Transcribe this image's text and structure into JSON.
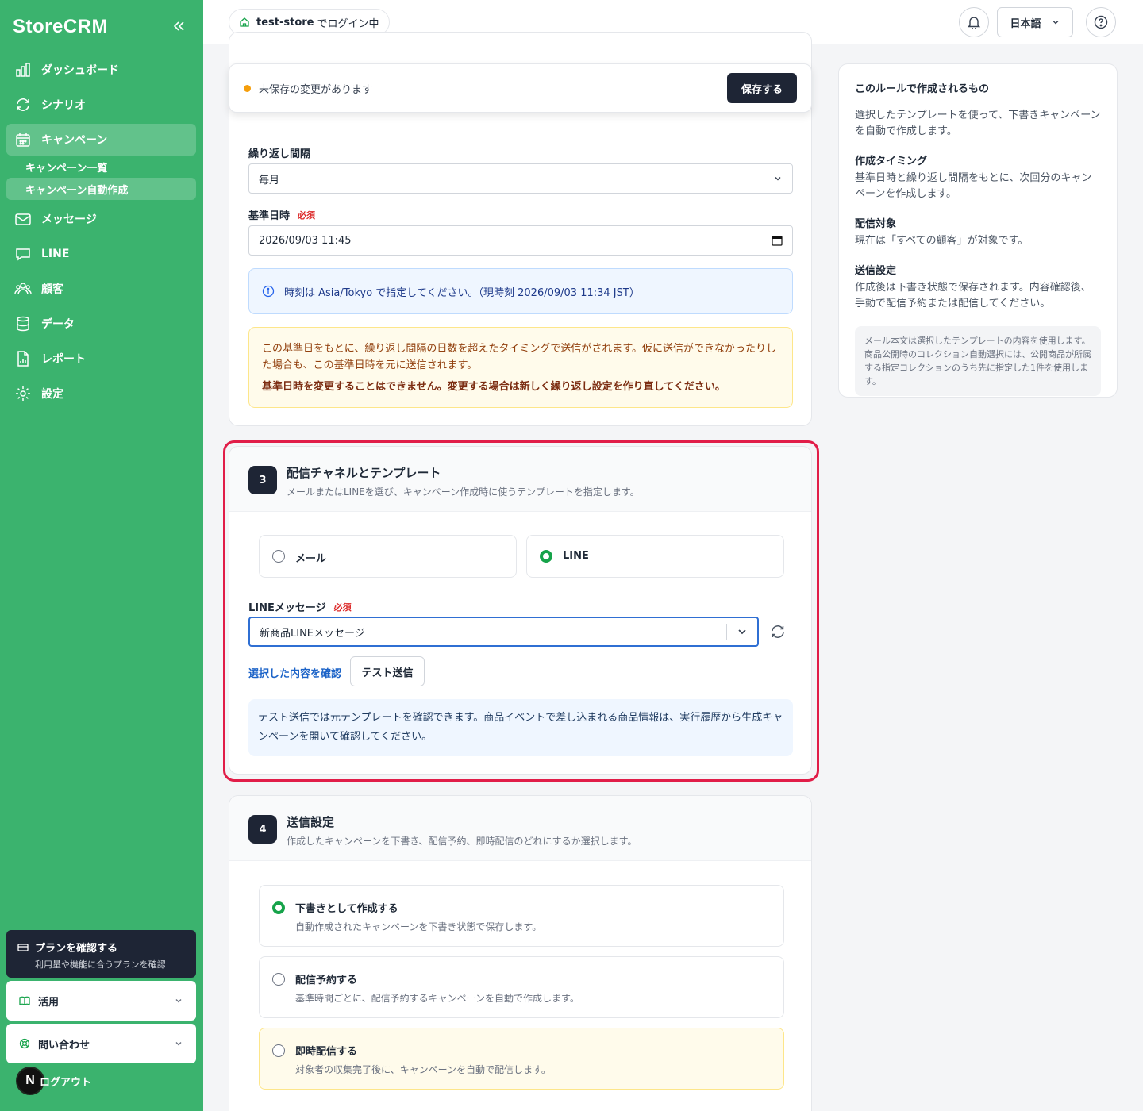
{
  "brand": "StoreCRM",
  "nav": [
    {
      "label": "ダッシュボード",
      "icon": "chart-bar-icon"
    },
    {
      "label": "シナリオ",
      "icon": "refresh-icon"
    },
    {
      "label": "キャンペーン",
      "icon": "calendar-icon"
    },
    {
      "label": "メッセージ",
      "icon": "mail-icon"
    },
    {
      "label": "LINE",
      "icon": "chat-icon"
    },
    {
      "label": "顧客",
      "icon": "users-icon"
    },
    {
      "label": "データ",
      "icon": "database-icon"
    },
    {
      "label": "レポート",
      "icon": "report-icon"
    },
    {
      "label": "設定",
      "icon": "gear-icon"
    }
  ],
  "subnav": [
    "キャンペーン一覧",
    "キャンペーン自動作成"
  ],
  "plan": {
    "title": "プランを確認する",
    "subtitle": "利用量や機能に合うプランを確認"
  },
  "side_dropdowns": [
    "活用",
    "問い合わせ"
  ],
  "logout": "ログアウト",
  "logout_badge": "N",
  "topbar": {
    "store": "test-store",
    "store_suffix": "でログイン中",
    "language": "日本語"
  },
  "unsaved": {
    "text": "未保存の変更があります",
    "save": "保存する"
  },
  "schedule": {
    "interval_label": "繰り返し間隔",
    "interval_value": "毎月",
    "base_label": "基準日時",
    "required": "必須",
    "base_value": "2026/09/03 11:45",
    "tz_note": "時刻は Asia/Tokyo で指定してください。（現時刻 2026/09/03 11:34 JST）",
    "warning": "この基準日をもとに、繰り返し間隔の日数を超えたタイミングで送信がされます。仮に送信ができなかったりした場合も、この基準日時を元に送信されます。",
    "warning_strong": "基準日時を変更することはできません。変更する場合は新しく繰り返し設定を作り直してください。"
  },
  "step3": {
    "num": "3",
    "title": "配信チャネルとテンプレート",
    "desc": "メールまたはLINEを選び、キャンペーン作成時に使うテンプレートを指定します。",
    "opt_mail": "メール",
    "opt_line": "LINE",
    "field_label": "LINEメッセージ",
    "required": "必須",
    "selected": "新商品LINEメッセージ",
    "confirm_link": "選択した内容を確認",
    "test_send": "テスト送信",
    "note": "テスト送信では元テンプレートを確認できます。商品イベントで差し込まれる商品情報は、実行履歴から生成キャンペーンを開いて確認してください。"
  },
  "step4": {
    "num": "4",
    "title": "送信設定",
    "desc": "作成したキャンペーンを下書き、配信予約、即時配信のどれにするか選択します。",
    "options": [
      {
        "label": "下書きとして作成する",
        "desc": "自動作成されたキャンペーンを下書き状態で保存します。"
      },
      {
        "label": "配信予約する",
        "desc": "基準時間ごとに、配信予約するキャンペーンを自動で作成します。"
      },
      {
        "label": "即時配信する",
        "desc": "対象者の収集完了後に、キャンペーンを自動で配信します。"
      }
    ]
  },
  "side_panel": {
    "title": "このルールで作成されるもの",
    "intro": "選択したテンプレートを使って、下書きキャンペーンを自動で作成します。",
    "h1": "作成タイミング",
    "t1": "基準日時と繰り返し間隔をもとに、次回分のキャンペーンを作成します。",
    "h2": "配信対象",
    "t2": "現在は「すべての顧客」が対象です。",
    "h3": "送信設定",
    "t3": "作成後は下書き状態で保存されます。内容確認後、手動で配信予約または配信してください。",
    "note": "メール本文は選択したテンプレートの内容を使用します。商品公開時のコレクション自動選択には、公開商品が所属する指定コレクションのうち先に指定した1件を使用します。"
  },
  "colors": {
    "sidebar": "#3bb36e",
    "dark": "#1e2535",
    "highlight": "#e11d48",
    "radio_on": "#16a34a",
    "required": "#dc2626"
  }
}
